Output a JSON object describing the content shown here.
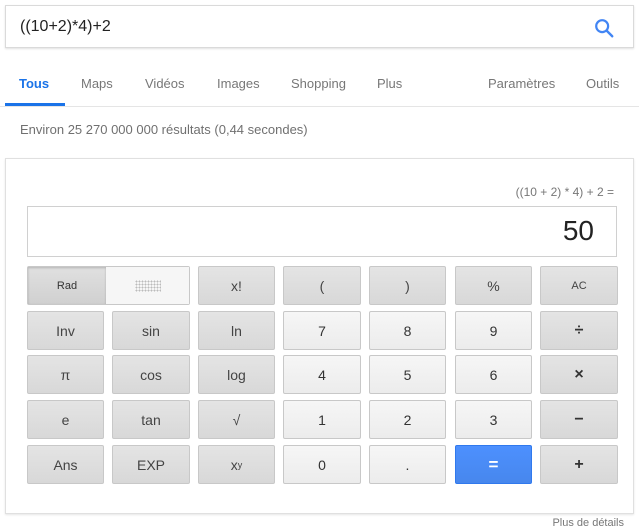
{
  "search": {
    "query": "((10+2)*4)+2"
  },
  "tabs": {
    "all": "Tous",
    "maps": "Maps",
    "videos": "Vidéos",
    "images": "Images",
    "shopping": "Shopping",
    "more": "Plus",
    "settings": "Paramètres",
    "tools": "Outils"
  },
  "stats": "Environ 25 270 000 000 résultats (0,44 secondes)",
  "calculator": {
    "expression": "((10 + 2) * 4) + 2 =",
    "result": "50",
    "keys": {
      "rad": "Rad",
      "fact": "x!",
      "lparen": "(",
      "rparen": ")",
      "percent": "%",
      "ac": "AC",
      "inv": "Inv",
      "sin": "sin",
      "ln": "ln",
      "seven": "7",
      "eight": "8",
      "nine": "9",
      "divide": "÷",
      "pi": "π",
      "cos": "cos",
      "log": "log",
      "four": "4",
      "five": "5",
      "six": "6",
      "multiply": "×",
      "e": "e",
      "tan": "tan",
      "sqrt": "√",
      "one": "1",
      "two": "2",
      "three": "3",
      "minus": "−",
      "ans": "Ans",
      "exp": "EXP",
      "pow_base": "x",
      "pow_exp": "y",
      "zero": "0",
      "dot": ".",
      "equals": "=",
      "plus": "+"
    }
  },
  "footer": {
    "more_details": "Plus de détails"
  },
  "colors": {
    "accent": "#1a73e8",
    "equals_button": "#4d90fe"
  }
}
